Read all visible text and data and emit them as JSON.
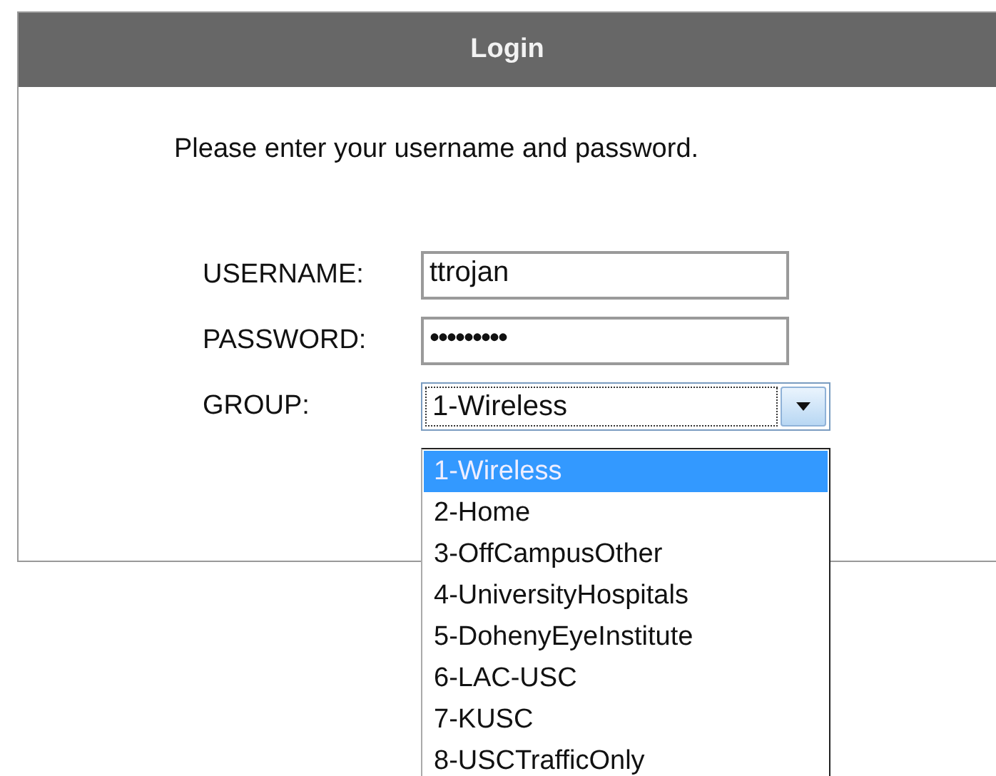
{
  "panel": {
    "title": "Login",
    "message": "Please enter your username and password."
  },
  "fields": [
    {
      "kind": "text",
      "label": "USERNAME:",
      "value": "ttrojan"
    },
    {
      "kind": "password",
      "label": "PASSWORD:",
      "value": "•••••••••"
    },
    {
      "kind": "select",
      "label": "GROUP:",
      "value": "1-Wireless",
      "expanded": true
    }
  ],
  "options": [
    {
      "label": "1-Wireless",
      "selected": true
    },
    {
      "label": "2-Home",
      "selected": false
    },
    {
      "label": "3-OffCampusOther",
      "selected": false
    },
    {
      "label": "4-UniversityHospitals",
      "selected": false
    },
    {
      "label": "5-DohenyEyeInstitute",
      "selected": false
    },
    {
      "label": "6-LAC-USC",
      "selected": false
    },
    {
      "label": "7-KUSC",
      "selected": false
    },
    {
      "label": "8-USCTrafficOnly",
      "selected": false
    }
  ]
}
